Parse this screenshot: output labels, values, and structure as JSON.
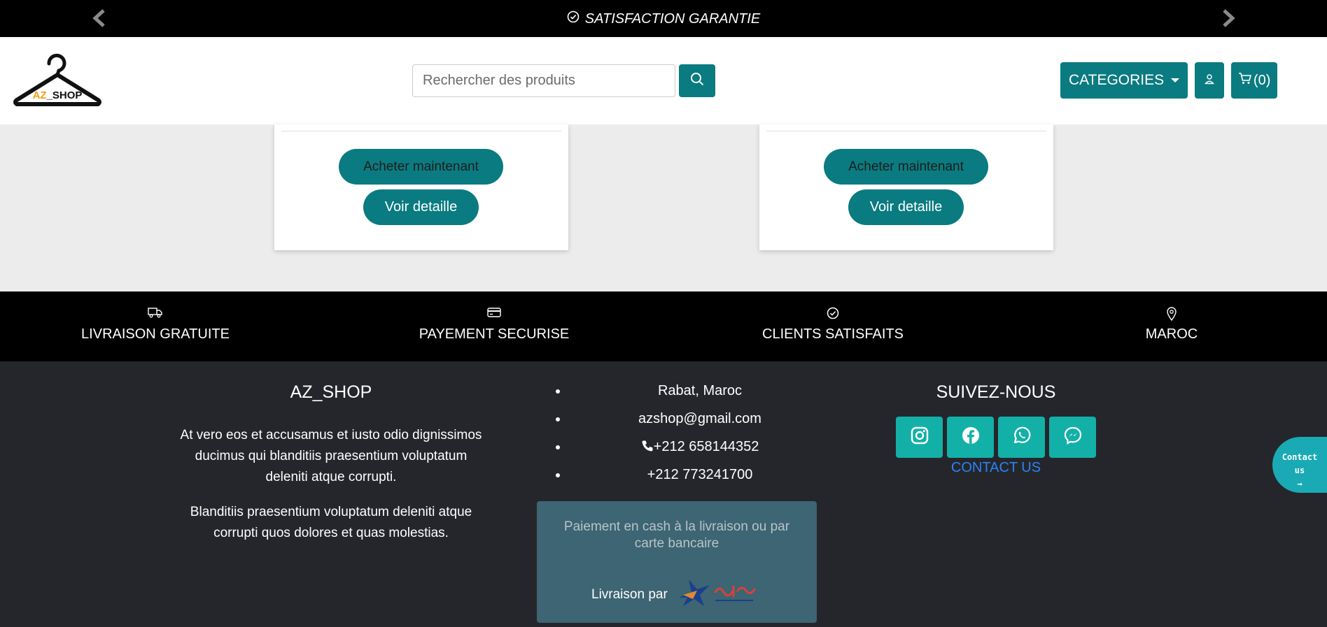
{
  "topbar": {
    "announcement": "SATISFACTION GARANTIE",
    "prev_icon": "chevron-left-icon",
    "next_icon": "chevron-right-icon"
  },
  "header": {
    "logo_text": "AZ_SHOP",
    "search": {
      "placeholder": "Rechercher des produits",
      "value": ""
    },
    "categories_label": "CATEGORIES",
    "cart_label": "(0)"
  },
  "products": [
    {
      "buy_label": "Acheter maintenant",
      "detail_label": "Voir detaille"
    },
    {
      "buy_label": "Acheter maintenant",
      "detail_label": "Voir detaille"
    }
  ],
  "features": [
    {
      "icon": "truck-icon",
      "label": "LIVRAISON GRATUITE"
    },
    {
      "icon": "credit-card-icon",
      "label": "PAYEMENT SECURISE"
    },
    {
      "icon": "check-circle-icon",
      "label": "CLIENTS SATISFAITS"
    },
    {
      "icon": "location-pin-icon",
      "label": "MAROC"
    }
  ],
  "footer": {
    "about": {
      "title": "AZ_SHOP",
      "paragraphs": [
        "At vero eos et accusamus et iusto odio dignissimos ducimus qui blanditiis praesentium voluptatum deleniti atque corrupti.",
        "Blanditiis praesentium voluptatum deleniti atque corrupti quos dolores et quas molestias."
      ]
    },
    "contact": {
      "items": [
        "Rabat, Maroc",
        "azshop@gmail.com",
        "+212 658144352",
        "+212 773241700"
      ],
      "payment_text": "Paiement en cash à la livraison ou par carte bancaire",
      "delivery_label": "Livraison par"
    },
    "social": {
      "title": "SUIVEZ-NOUS",
      "networks": [
        "instagram-icon",
        "facebook-icon",
        "whatsapp-icon",
        "messenger-icon"
      ],
      "contact_link": "CONTACT US"
    }
  },
  "floating_contact": {
    "line1": "Contact",
    "line2": "us",
    "line3": "→"
  },
  "colors": {
    "teal": "#0a7b80",
    "social_teal": "#13b0a8",
    "footer_bg": "#25262c",
    "paybox_bg": "#3d6573",
    "link_blue": "#2a84f3"
  }
}
